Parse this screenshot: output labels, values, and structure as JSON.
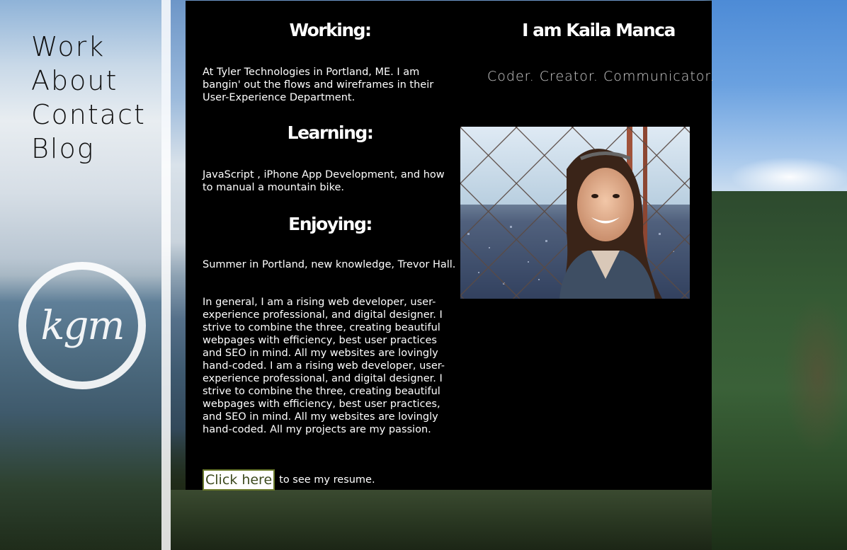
{
  "nav": {
    "items": [
      {
        "label": "Work"
      },
      {
        "label": "About"
      },
      {
        "label": "Contact"
      },
      {
        "label": "Blog"
      }
    ]
  },
  "logo": {
    "text": "kgm"
  },
  "sections": {
    "working": {
      "heading": "Working:",
      "text": "At Tyler Technologies in Portland, ME. I am bangin' out the flows and wireframes in their User-Experience Department."
    },
    "learning": {
      "heading": "Learning:",
      "text": "JavaScript , iPhone App Development, and how to manual a mountain bike."
    },
    "enjoying": {
      "heading": "Enjoying:",
      "text": "Summer in Portland, new knowledge, Trevor Hall."
    },
    "general": {
      "text": "In general, I am a rising web developer, user-experience professional, and digital designer. I strive to combine the three, creating beautiful webpages with efficiency, best user practices and SEO in mind. All my websites are lovingly hand-coded. I am a rising web developer, user-experience professional, and digital designer. I strive to combine the three, creating beautiful webpages with efficiency, best user practices, and SEO in mind. All my websites are lovingly hand-coded. All my projects are my passion."
    }
  },
  "resume": {
    "button_label": "Click here",
    "suffix": "to see my resume."
  },
  "profile": {
    "name": "I am Kaila Manca",
    "tagline": "Coder. Creator. Communicator."
  },
  "colors": {
    "panel": "#000000",
    "resume_border": "#6b7a2c",
    "tagline": "#cfcfcf"
  }
}
